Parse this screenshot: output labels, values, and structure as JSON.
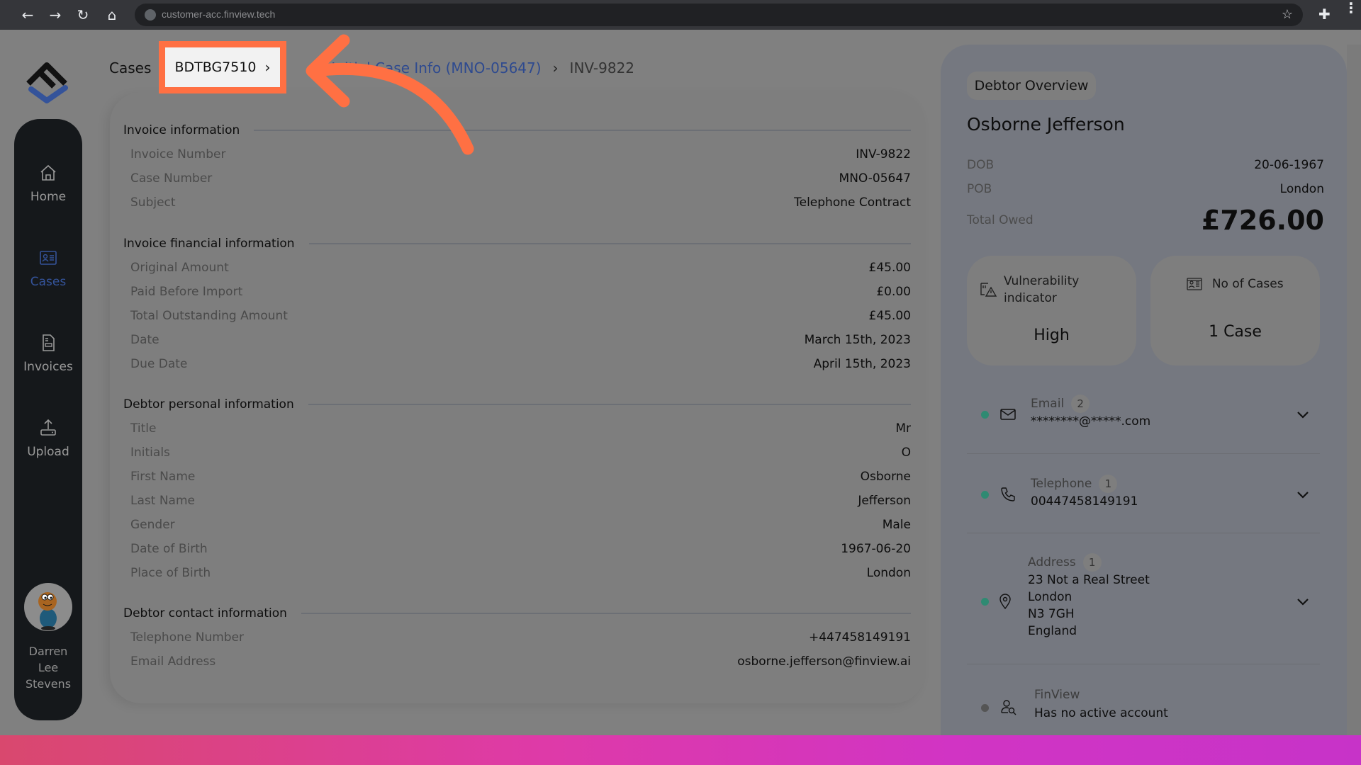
{
  "browser": {
    "url": "customer-acc.finview.tech",
    "nav_icons": [
      "back-arrow-icon",
      "forward-arrow-icon",
      "reload-icon",
      "home-icon"
    ],
    "right_icons": [
      "bookmark-star-icon",
      "extensions-puzzle-icon",
      "kebab-menu-icon"
    ]
  },
  "sidebar": {
    "items": [
      {
        "label": "Home",
        "icon": "home-icon",
        "active": false
      },
      {
        "label": "Cases",
        "icon": "id-card-icon",
        "active": true
      },
      {
        "label": "Invoices",
        "icon": "invoice-document-icon",
        "active": false
      },
      {
        "label": "Upload",
        "icon": "upload-icon",
        "active": false
      }
    ],
    "user": {
      "name": "Darren Lee Stevens",
      "name_lines": [
        "Darren",
        "Lee",
        "Stevens"
      ]
    }
  },
  "breadcrumb": {
    "items": [
      "Cases",
      "BDTBG7510",
      "Initial Case Info (MNO-05647)",
      "INV-9822"
    ],
    "separator": "›"
  },
  "invoice": {
    "sections": [
      {
        "title": "Invoice information",
        "rows": [
          {
            "label": "Invoice Number",
            "value": "INV-9822"
          },
          {
            "label": "Case Number",
            "value": "MNO-05647"
          },
          {
            "label": "Subject",
            "value": "Telephone Contract"
          }
        ]
      },
      {
        "title": "Invoice financial information",
        "rows": [
          {
            "label": "Original Amount",
            "value": "£45.00"
          },
          {
            "label": "Paid Before Import",
            "value": "£0.00"
          },
          {
            "label": "Total Outstanding Amount",
            "value": "£45.00"
          },
          {
            "label": "Date",
            "value": "March 15th, 2023"
          },
          {
            "label": "Due Date",
            "value": "April 15th, 2023"
          }
        ]
      },
      {
        "title": "Debtor personal information",
        "rows": [
          {
            "label": "Title",
            "value": "Mr"
          },
          {
            "label": "Initials",
            "value": "O"
          },
          {
            "label": "First Name",
            "value": "Osborne"
          },
          {
            "label": "Last Name",
            "value": "Jefferson"
          },
          {
            "label": "Gender",
            "value": "Male"
          },
          {
            "label": "Date of Birth",
            "value": "1967-06-20"
          },
          {
            "label": "Place of Birth",
            "value": "London"
          }
        ]
      },
      {
        "title": "Debtor contact information",
        "rows": [
          {
            "label": "Telephone Number",
            "value": "+447458149191"
          },
          {
            "label": "Email Address",
            "value": "osborne.jefferson@finview.ai"
          }
        ]
      }
    ]
  },
  "debtor_overview": {
    "pill_label": "Debtor Overview",
    "name": "Osborne Jefferson",
    "dob_label": "DOB",
    "dob": "20-06-1967",
    "pob_label": "POB",
    "pob": "London",
    "total_owed_label": "Total Owed",
    "total_owed": "£726.00",
    "vulnerability": {
      "label_line1": "Vulnerability",
      "label_line2": "indicator",
      "value": "High"
    },
    "cases": {
      "label": "No of Cases",
      "value": "1 Case"
    },
    "contacts": [
      {
        "title": "Email",
        "count": "2",
        "text": "********@*****.com",
        "status": "active",
        "status_color": "#2f8a72"
      },
      {
        "title": "Telephone",
        "count": "1",
        "text": "00447458149191",
        "status": "active",
        "status_color": "#2f8a72"
      },
      {
        "title": "Address",
        "count": "1",
        "lines": [
          "23 Not a Real Street",
          "London",
          "N3 7GH",
          "England"
        ],
        "status": "active",
        "status_color": "#2f8a72"
      },
      {
        "title": "FinView",
        "text": "Has no active account",
        "status": "inactive",
        "status_color": "#555555"
      }
    ]
  },
  "annotation": {
    "highlight_color": "#ff7043",
    "highlighted_item": "BDTBG7510"
  }
}
